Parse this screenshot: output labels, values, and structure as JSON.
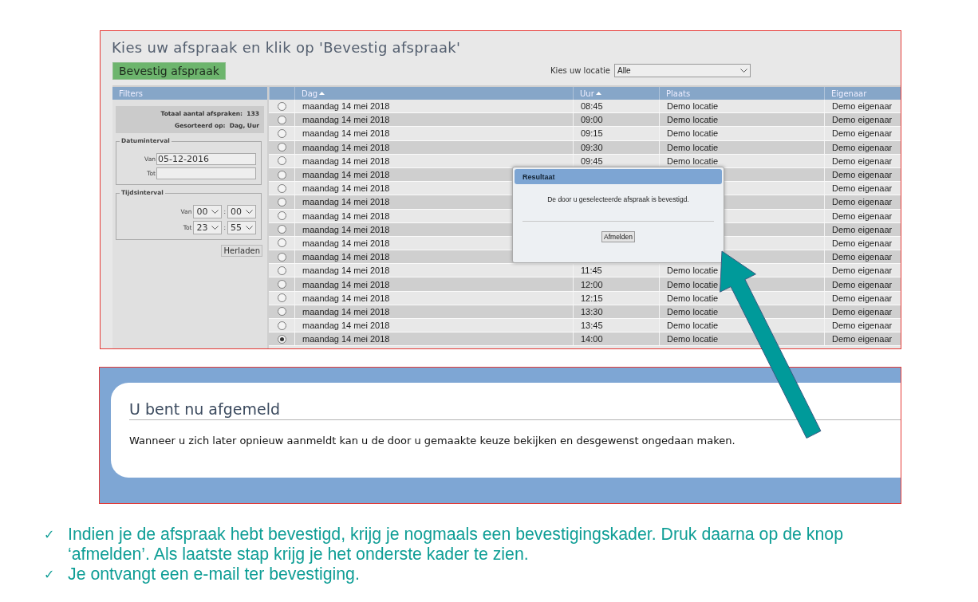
{
  "top_screen": {
    "title": "Kies uw afspraak en klik op 'Bevestig afspraak'",
    "confirm_button": "Bevestig afspraak",
    "location": {
      "label": "Kies uw locatie",
      "value": "Alle"
    },
    "filters": {
      "header": "Filters",
      "total_label": "Totaal aantal afspraken:",
      "total_value": "133",
      "sorted_label": "Gesorteerd op:",
      "sorted_value": "Dag, Uur",
      "date_interval": {
        "legend": "Datuminterval",
        "from_label": "Van",
        "from_value": "05-12-2016",
        "to_label": "Tot"
      },
      "time_interval": {
        "legend": "Tijdsinterval",
        "from_label": "Van",
        "from_hour": "00",
        "from_minute": "00",
        "to_label": "Tot",
        "to_hour": "23",
        "to_minute": "55",
        "separator": ":"
      },
      "reload_button": "Herladen"
    },
    "table": {
      "columns": [
        {
          "label": "Dag",
          "sorted": true
        },
        {
          "label": "Uur",
          "sorted": true
        },
        {
          "label": "Plaats",
          "sorted": false
        },
        {
          "label": "Eigenaar",
          "sorted": false
        }
      ],
      "rows": [
        {
          "selected": false,
          "dag": "maandag 14 mei 2018",
          "uur": "08:45",
          "plaats": "Demo locatie",
          "eigenaar": "Demo eigenaar"
        },
        {
          "selected": false,
          "dag": "maandag 14 mei 2018",
          "uur": "09:00",
          "plaats": "Demo locatie",
          "eigenaar": "Demo eigenaar"
        },
        {
          "selected": false,
          "dag": "maandag 14 mei 2018",
          "uur": "09:15",
          "plaats": "Demo locatie",
          "eigenaar": "Demo eigenaar"
        },
        {
          "selected": false,
          "dag": "maandag 14 mei 2018",
          "uur": "09:30",
          "plaats": "Demo locatie",
          "eigenaar": "Demo eigenaar"
        },
        {
          "selected": false,
          "dag": "maandag 14 mei 2018",
          "uur": "09:45",
          "plaats": "Demo locatie",
          "eigenaar": "Demo eigenaar"
        },
        {
          "selected": false,
          "dag": "maandag 14 mei 2018",
          "eigenaar": "Demo eigenaar"
        },
        {
          "selected": false,
          "dag": "maandag 14 mei 2018",
          "eigenaar": "Demo eigenaar"
        },
        {
          "selected": false,
          "dag": "maandag 14 mei 2018",
          "eigenaar": "Demo eigenaar"
        },
        {
          "selected": false,
          "dag": "maandag 14 mei 2018",
          "eigenaar": "Demo eigenaar"
        },
        {
          "selected": false,
          "dag": "maandag 14 mei 2018",
          "eigenaar": "Demo eigenaar"
        },
        {
          "selected": false,
          "dag": "maandag 14 mei 2018",
          "eigenaar": "Demo eigenaar"
        },
        {
          "selected": false,
          "dag": "maandag 14 mei 2018",
          "eigenaar": "Demo eigenaar"
        },
        {
          "selected": false,
          "dag": "maandag 14 mei 2018",
          "uur": "11:45",
          "plaats": "Demo locatie",
          "eigenaar": "Demo eigenaar"
        },
        {
          "selected": false,
          "dag": "maandag 14 mei 2018",
          "uur": "12:00",
          "plaats": "Demo locatie",
          "eigenaar": "Demo eigenaar"
        },
        {
          "selected": false,
          "dag": "maandag 14 mei 2018",
          "uur": "12:15",
          "plaats": "Demo locatie",
          "eigenaar": "Demo eigenaar"
        },
        {
          "selected": false,
          "dag": "maandag 14 mei 2018",
          "uur": "13:30",
          "plaats": "Demo locatie",
          "eigenaar": "Demo eigenaar"
        },
        {
          "selected": false,
          "dag": "maandag 14 mei 2018",
          "uur": "13:45",
          "plaats": "Demo locatie",
          "eigenaar": "Demo eigenaar"
        },
        {
          "selected": true,
          "dag": "maandag 14 mei 2018",
          "uur": "14:00",
          "plaats": "Demo locatie",
          "eigenaar": "Demo eigenaar"
        }
      ]
    },
    "dialog": {
      "title": "Resultaat",
      "message": "De door u geselecteerde afspraak is bevestigd.",
      "button": "Afmelden"
    }
  },
  "bottom_screen": {
    "title": "U bent nu afgemeld",
    "message": "Wanneer u zich later opnieuw aanmeldt kan u de door u gemaakte keuze bekijken en desgewenst ongedaan maken."
  },
  "bullets": [
    {
      "mark": "✓",
      "text": "Indien je de afspraak hebt bevestigd, krijg je nogmaals een bevestigingskader. Druk daarna op de knop ‘afmelden’. Als laatste stap krijg je het onderste kader te zien."
    },
    {
      "mark": "✓",
      "text": "Je ontvangt een e-mail ter bevestiging."
    }
  ]
}
